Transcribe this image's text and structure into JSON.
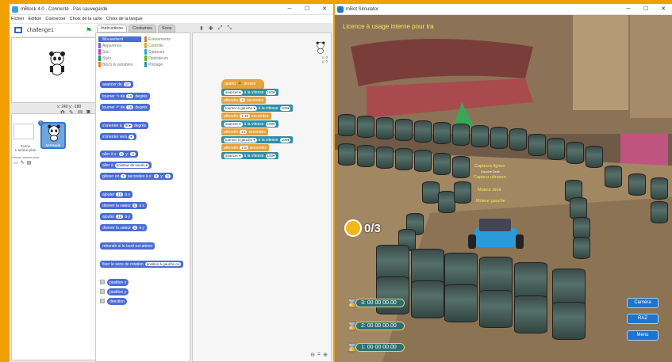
{
  "mblock": {
    "title": "mBlock 4.0 - Connecté - Pas sauvegardé",
    "menu": [
      "Fichier",
      "Edition",
      "Connecter",
      "Choix de la carte",
      "Choix de la langue"
    ],
    "sprite_name": "challenge1",
    "coords": "x: 240  y: -180",
    "tabs": [
      "Instructions",
      "Costumes",
      "Sons"
    ],
    "categories": [
      {
        "label": "Mouvement",
        "color": "#4a6cd4",
        "selected": true
      },
      {
        "label": "Evènements",
        "color": "#c88330",
        "selected": false
      },
      {
        "label": "Apparence",
        "color": "#8a55d7",
        "selected": false
      },
      {
        "label": "Contrôle",
        "color": "#e1a91a",
        "selected": false
      },
      {
        "label": "Son",
        "color": "#bb42c3",
        "selected": false
      },
      {
        "label": "Capteurs",
        "color": "#2ca5e2",
        "selected": false
      },
      {
        "label": "Stylo",
        "color": "#0e9a6c",
        "selected": false
      },
      {
        "label": "Opérateurs",
        "color": "#5cb712",
        "selected": false
      },
      {
        "label": "Blocs & variables",
        "color": "#ee7d16",
        "selected": false
      },
      {
        "label": "Pilotage",
        "color": "#2d8fa8",
        "selected": false
      }
    ],
    "palette_blocks": {
      "b1_text": "avancer de",
      "b1_val": "10",
      "b2_text": "tourner ↷ de",
      "b2_val": "15",
      "b2_unit": "degrés",
      "b3_text": "tourner ↶ de",
      "b3_val": "15",
      "b3_unit": "degrés",
      "b4_text": "s'orienter à",
      "b4_val": "90▾",
      "b4_unit": "degrés",
      "b5_text": "s'orienter vers",
      "b6_text": "aller à x:",
      "b6_v1": "0",
      "b6_mid": "y:",
      "b6_v2": "0",
      "b7_text": "aller à",
      "b7_val": "pointeur de souris ▾",
      "b8_text": "glisser en",
      "b8_v1": "1",
      "b8_mid": "secondes à x:",
      "b8_v2": "0",
      "b8_mid2": "y:",
      "b8_v3": "0",
      "b9_text": "ajouter",
      "b9_val": "10",
      "b9_end": "à x",
      "b10_text": "donner la valeur",
      "b10_val": "0",
      "b10_end": "à x",
      "b11_text": "ajouter",
      "b11_val": "10",
      "b11_end": "à y",
      "b12_text": "donner la valeur",
      "b12_val": "0",
      "b12_end": "à y",
      "b13_text": "rebondir si le bord est atteint",
      "b14_text": "fixer le sens de rotation",
      "b14_val": "position à gauche ou",
      "r1": "position x",
      "r2": "position y",
      "r3": "direction"
    },
    "stage_sprite_coords": "x: 0\ny: 0",
    "sprite_list": {
      "stage_label": "Scène\n1 arrière-plan",
      "new_bg": "Nouvel arrière-plan:",
      "sprite_label": "M-Panda"
    },
    "script": {
      "hat_text": "quand",
      "hat_text2": "pressé",
      "s1": "avancer ▾",
      "s1b": "à la vitesse",
      "s1v": "100▾",
      "s2": "attendre",
      "s2v": "2",
      "s2b": "secondes",
      "s3": "tourner à gauche ▾",
      "s3b": "à la vitesse",
      "s3v": "100▾",
      "s4": "attendre",
      "s4v": "1.45",
      "s4b": "secondes",
      "s5": "avancer ▾",
      "s5b": "à la vitesse",
      "s5v": "100▾",
      "s6": "attendre",
      "s6v": "10",
      "s6b": "secondes",
      "s7": "tourner à gauche ▾",
      "s7b": "à la vitesse",
      "s7v": "100▾",
      "s8": "attendre",
      "s8v": "1.8",
      "s8b": "secondes",
      "s9": "avancer ▾",
      "s9b": "à la vitesse",
      "s9v": "100▾"
    }
  },
  "sim": {
    "title": "mBot Simulator",
    "license": "Licence à usage interne pour Ira",
    "score": "0/3",
    "timers": [
      "3: 00 00 00.00",
      "2: 00 00 00.00",
      "1: 00 00 00.00"
    ],
    "buttons": {
      "camera": "Caméra",
      "raz": "RAZ",
      "menu": "Menu"
    },
    "sensor_labels": {
      "l1": "Capteurs lignes",
      "l1b": "Gauche  Droit",
      "l2": "Capteur ultrason",
      "l3": "Moteur droit",
      "l4": "Moteur gauche"
    }
  }
}
